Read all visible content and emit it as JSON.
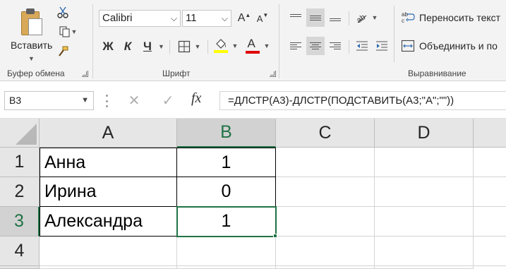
{
  "ribbon": {
    "clipboard": {
      "paste_label": "Вставить",
      "group_label": "Буфер обмена"
    },
    "font": {
      "font_name": "Calibri",
      "font_size": "11",
      "grow_label": "A",
      "shrink_label": "A",
      "bold_label": "Ж",
      "italic_label": "К",
      "underline_label": "Ч",
      "font_color_label": "A",
      "group_label": "Шрифт",
      "highlight_color": "#ffff00",
      "font_color": "#e00000"
    },
    "alignment": {
      "orientation_label": "ab",
      "wrap_text_label": "Переносить текст",
      "merge_label": "Объединить и по",
      "group_label": "Выравнивание"
    }
  },
  "formula_bar": {
    "name_box": "B3",
    "cancel_symbol": "✕",
    "enter_symbol": "✓",
    "fx_label": "fx",
    "formula": "=ДЛСТР(A3)-ДЛСТР(ПОДСТАВИТЬ(A3;\"А\";\"\"))"
  },
  "sheet": {
    "columns": [
      "A",
      "B",
      "C",
      "D"
    ],
    "rows": [
      "1",
      "2",
      "3",
      "4"
    ],
    "cells": {
      "A1": "Анна",
      "B1": "1",
      "A2": "Ирина",
      "B2": "0",
      "A3": "Александра",
      "B3": "1"
    },
    "selected_cell": "B3",
    "accent_color": "#217346"
  }
}
